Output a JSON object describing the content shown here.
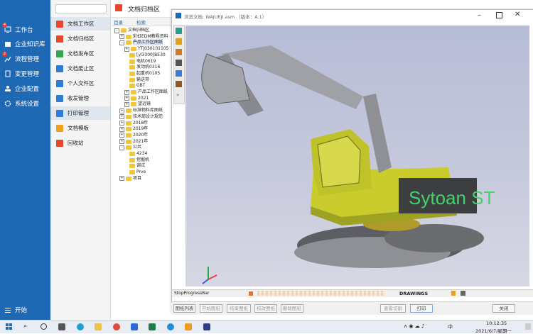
{
  "left_nav": {
    "items": [
      {
        "label": "工作台",
        "badge": "4"
      },
      {
        "label": "企业知识库",
        "badge": ""
      },
      {
        "label": "流程管理",
        "badge": "2"
      },
      {
        "label": "变更管理",
        "badge": ""
      },
      {
        "label": "企业配置",
        "badge": ""
      },
      {
        "label": "系统设置",
        "badge": ""
      }
    ],
    "start_label": "开始"
  },
  "sub_nav": {
    "items": [
      {
        "label": "文档工作区",
        "color": "#e8462f"
      },
      {
        "label": "文档归档区",
        "color": "#e8462f"
      },
      {
        "label": "文档发布区",
        "color": "#2fa84f"
      },
      {
        "label": "文档废止区",
        "color": "#2f7bd8"
      },
      {
        "label": "个人文件区",
        "color": "#2f7bd8"
      },
      {
        "label": "收发管理",
        "color": "#2f7bd8"
      },
      {
        "label": "打印管理",
        "color": "#2f7bd8"
      },
      {
        "label": "文档模板",
        "color": "#f0a020"
      },
      {
        "label": "回收站",
        "color": "#e8462f"
      }
    ]
  },
  "header": {
    "title": "文档归档区"
  },
  "tree": {
    "tabs": [
      "目录",
      "检索"
    ],
    "rows": [
      {
        "label": "文档归档区",
        "level": 0,
        "pm": "-"
      },
      {
        "label": "彩虹EDM教程资料",
        "level": 1,
        "pm": "+"
      },
      {
        "label": "产品工作区图纸",
        "level": 1,
        "pm": "-"
      },
      {
        "label": "YTJ030101105",
        "level": 2,
        "pm": "+"
      },
      {
        "label": "[yl3300]BE30",
        "level": 2,
        "pm": ""
      },
      {
        "label": "电机0619",
        "level": 2,
        "pm": ""
      },
      {
        "label": "发动机0316",
        "level": 2,
        "pm": ""
      },
      {
        "label": "起重机0105",
        "level": 2,
        "pm": ""
      },
      {
        "label": "输送带",
        "level": 2,
        "pm": ""
      },
      {
        "label": "GBT",
        "level": 2,
        "pm": ""
      },
      {
        "label": "产品工作区图纸",
        "level": 2,
        "pm": "+"
      },
      {
        "label": "2021",
        "level": 2,
        "pm": "+"
      },
      {
        "label": "望远镜",
        "level": 2,
        "pm": "+"
      },
      {
        "label": "标准物料库图纸",
        "level": 1,
        "pm": "+"
      },
      {
        "label": "技术部设计规范",
        "level": 1,
        "pm": "+"
      },
      {
        "label": "2018年",
        "level": 1,
        "pm": "+"
      },
      {
        "label": "2019年",
        "level": 1,
        "pm": "+"
      },
      {
        "label": "2020年",
        "level": 1,
        "pm": "+"
      },
      {
        "label": "2021年",
        "level": 1,
        "pm": "+"
      },
      {
        "label": "公共",
        "level": 1,
        "pm": "-"
      },
      {
        "label": "4234",
        "level": 2,
        "pm": ""
      },
      {
        "label": "挖掘机",
        "level": 2,
        "pm": ""
      },
      {
        "label": "调试",
        "level": 2,
        "pm": ""
      },
      {
        "label": "Prve",
        "level": 2,
        "pm": ""
      },
      {
        "label": "项目",
        "level": 1,
        "pm": "+"
      }
    ]
  },
  "viewer": {
    "title": "浏览文档: WAJUEJI.asm （版本：A.1）",
    "model_text": "Sytoan ST",
    "status_left": "StopProgressBar",
    "status_mid": "DRAWINGS",
    "buttons": [
      "图纸列表",
      "开始图纸",
      "结束图纸",
      "校改图纸",
      "删除图纸",
      "查看切割",
      "打印",
      "关闭"
    ]
  },
  "taskbar": {
    "time": "10:12:35",
    "date": "2021/6/7/星期一",
    "ime": "中"
  }
}
